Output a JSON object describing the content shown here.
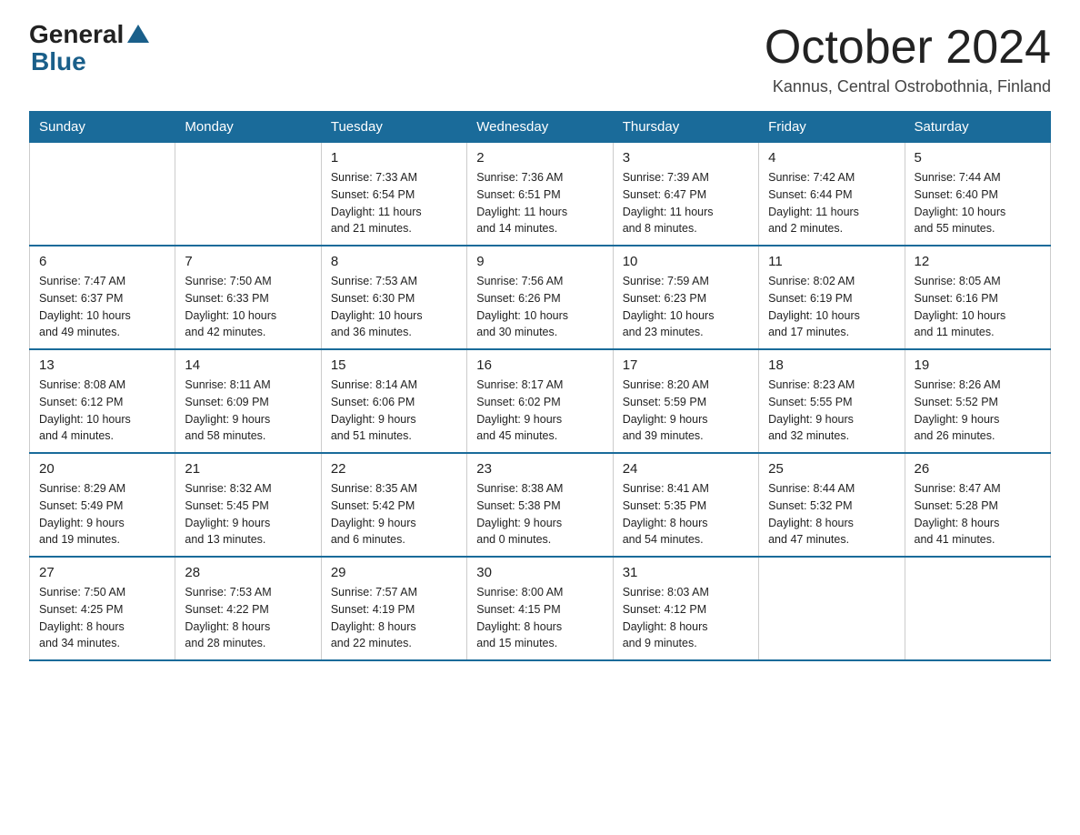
{
  "logo": {
    "general": "General",
    "blue": "Blue"
  },
  "header": {
    "month_year": "October 2024",
    "location": "Kannus, Central Ostrobothnia, Finland"
  },
  "days_of_week": [
    "Sunday",
    "Monday",
    "Tuesday",
    "Wednesday",
    "Thursday",
    "Friday",
    "Saturday"
  ],
  "weeks": [
    [
      null,
      null,
      {
        "date": "1",
        "sunrise": "7:33 AM",
        "sunset": "6:54 PM",
        "daylight": "11 hours and 21 minutes."
      },
      {
        "date": "2",
        "sunrise": "7:36 AM",
        "sunset": "6:51 PM",
        "daylight": "11 hours and 14 minutes."
      },
      {
        "date": "3",
        "sunrise": "7:39 AM",
        "sunset": "6:47 PM",
        "daylight": "11 hours and 8 minutes."
      },
      {
        "date": "4",
        "sunrise": "7:42 AM",
        "sunset": "6:44 PM",
        "daylight": "11 hours and 2 minutes."
      },
      {
        "date": "5",
        "sunrise": "7:44 AM",
        "sunset": "6:40 PM",
        "daylight": "10 hours and 55 minutes."
      }
    ],
    [
      {
        "date": "6",
        "sunrise": "7:47 AM",
        "sunset": "6:37 PM",
        "daylight": "10 hours and 49 minutes."
      },
      {
        "date": "7",
        "sunrise": "7:50 AM",
        "sunset": "6:33 PM",
        "daylight": "10 hours and 42 minutes."
      },
      {
        "date": "8",
        "sunrise": "7:53 AM",
        "sunset": "6:30 PM",
        "daylight": "10 hours and 36 minutes."
      },
      {
        "date": "9",
        "sunrise": "7:56 AM",
        "sunset": "6:26 PM",
        "daylight": "10 hours and 30 minutes."
      },
      {
        "date": "10",
        "sunrise": "7:59 AM",
        "sunset": "6:23 PM",
        "daylight": "10 hours and 23 minutes."
      },
      {
        "date": "11",
        "sunrise": "8:02 AM",
        "sunset": "6:19 PM",
        "daylight": "10 hours and 17 minutes."
      },
      {
        "date": "12",
        "sunrise": "8:05 AM",
        "sunset": "6:16 PM",
        "daylight": "10 hours and 11 minutes."
      }
    ],
    [
      {
        "date": "13",
        "sunrise": "8:08 AM",
        "sunset": "6:12 PM",
        "daylight": "10 hours and 4 minutes."
      },
      {
        "date": "14",
        "sunrise": "8:11 AM",
        "sunset": "6:09 PM",
        "daylight": "9 hours and 58 minutes."
      },
      {
        "date": "15",
        "sunrise": "8:14 AM",
        "sunset": "6:06 PM",
        "daylight": "9 hours and 51 minutes."
      },
      {
        "date": "16",
        "sunrise": "8:17 AM",
        "sunset": "6:02 PM",
        "daylight": "9 hours and 45 minutes."
      },
      {
        "date": "17",
        "sunrise": "8:20 AM",
        "sunset": "5:59 PM",
        "daylight": "9 hours and 39 minutes."
      },
      {
        "date": "18",
        "sunrise": "8:23 AM",
        "sunset": "5:55 PM",
        "daylight": "9 hours and 32 minutes."
      },
      {
        "date": "19",
        "sunrise": "8:26 AM",
        "sunset": "5:52 PM",
        "daylight": "9 hours and 26 minutes."
      }
    ],
    [
      {
        "date": "20",
        "sunrise": "8:29 AM",
        "sunset": "5:49 PM",
        "daylight": "9 hours and 19 minutes."
      },
      {
        "date": "21",
        "sunrise": "8:32 AM",
        "sunset": "5:45 PM",
        "daylight": "9 hours and 13 minutes."
      },
      {
        "date": "22",
        "sunrise": "8:35 AM",
        "sunset": "5:42 PM",
        "daylight": "9 hours and 6 minutes."
      },
      {
        "date": "23",
        "sunrise": "8:38 AM",
        "sunset": "5:38 PM",
        "daylight": "9 hours and 0 minutes."
      },
      {
        "date": "24",
        "sunrise": "8:41 AM",
        "sunset": "5:35 PM",
        "daylight": "8 hours and 54 minutes."
      },
      {
        "date": "25",
        "sunrise": "8:44 AM",
        "sunset": "5:32 PM",
        "daylight": "8 hours and 47 minutes."
      },
      {
        "date": "26",
        "sunrise": "8:47 AM",
        "sunset": "5:28 PM",
        "daylight": "8 hours and 41 minutes."
      }
    ],
    [
      {
        "date": "27",
        "sunrise": "7:50 AM",
        "sunset": "4:25 PM",
        "daylight": "8 hours and 34 minutes."
      },
      {
        "date": "28",
        "sunrise": "7:53 AM",
        "sunset": "4:22 PM",
        "daylight": "8 hours and 28 minutes."
      },
      {
        "date": "29",
        "sunrise": "7:57 AM",
        "sunset": "4:19 PM",
        "daylight": "8 hours and 22 minutes."
      },
      {
        "date": "30",
        "sunrise": "8:00 AM",
        "sunset": "4:15 PM",
        "daylight": "8 hours and 15 minutes."
      },
      {
        "date": "31",
        "sunrise": "8:03 AM",
        "sunset": "4:12 PM",
        "daylight": "8 hours and 9 minutes."
      },
      null,
      null
    ]
  ],
  "labels": {
    "sunrise": "Sunrise:",
    "sunset": "Sunset:",
    "daylight": "Daylight:"
  }
}
